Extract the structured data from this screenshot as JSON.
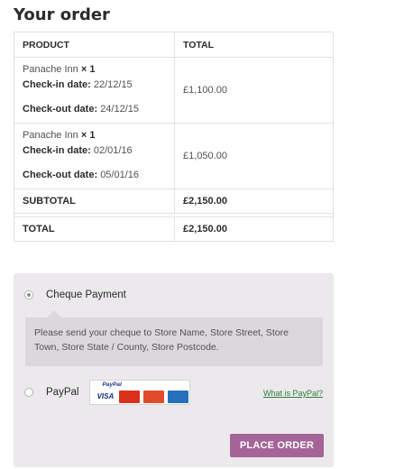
{
  "title": "Your order",
  "table": {
    "headers": {
      "product": "PRODUCT",
      "total": "TOTAL"
    },
    "items": [
      {
        "name": "Panache Inn",
        "qty": "× 1",
        "checkin_label": "Check-in date:",
        "checkin_value": "22/12/15",
        "checkout_label": "Check-out date:",
        "checkout_value": "24/12/15",
        "price": "£1,100.00"
      },
      {
        "name": "Panache Inn",
        "qty": "× 1",
        "checkin_label": "Check-in date:",
        "checkin_value": "02/01/16",
        "checkout_label": "Check-out date:",
        "checkout_value": "05/01/16",
        "price": "£1,050.00"
      }
    ],
    "subtotal_label": "SUBTOTAL",
    "subtotal_value": "£2,150.00",
    "total_label": "TOTAL",
    "total_value": "£2,150.00"
  },
  "payment": {
    "cheque_label": "Cheque Payment",
    "cheque_selected": true,
    "cheque_description": "Please send your cheque to Store Name, Store Street, Store Town, Store State / County, Store Postcode.",
    "paypal_label": "PayPal",
    "paypal_logo_text": "PayPal",
    "cards": [
      "VISA",
      "MasterCard",
      "Maestro",
      "AMEX"
    ],
    "what_is_paypal": "What is PayPal?",
    "place_order": "PLACE ORDER"
  },
  "colors": {
    "place_order_bg": "#a46497",
    "payment_box_bg": "#ebe9eb",
    "link_color": "#2f7d3f"
  }
}
